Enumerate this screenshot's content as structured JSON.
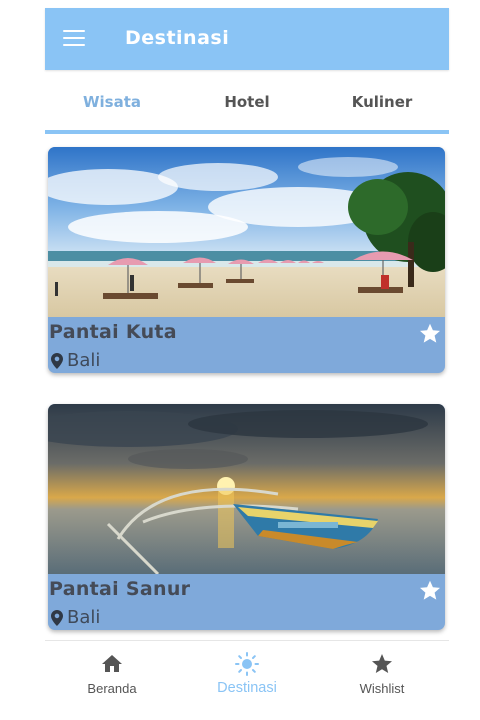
{
  "appbar": {
    "title": "Destinasi",
    "color": "#8ac4f5"
  },
  "tabs": [
    {
      "label": "Wisata",
      "active": true
    },
    {
      "label": "Hotel",
      "active": false
    },
    {
      "label": "Kuliner",
      "active": false
    }
  ],
  "cards": [
    {
      "title": "Pantai Kuta",
      "location": "Bali",
      "image": "beach-with-umbrellas-photo",
      "favorite_icon": "star-icon"
    },
    {
      "title": "Pantai Sanur",
      "location": "Bali",
      "image": "outrigger-boat-sunset-photo",
      "favorite_icon": "star-icon"
    }
  ],
  "bottom_nav": [
    {
      "label": "Beranda",
      "icon": "home-icon",
      "active": false
    },
    {
      "label": "Destinasi",
      "icon": "sun-icon",
      "active": true
    },
    {
      "label": "Wishlist",
      "icon": "star-icon",
      "active": false
    }
  ],
  "colors": {
    "accent": "#8ac4f5",
    "card_footer": "#7fa9da",
    "active_tab": "#7fb0de"
  }
}
